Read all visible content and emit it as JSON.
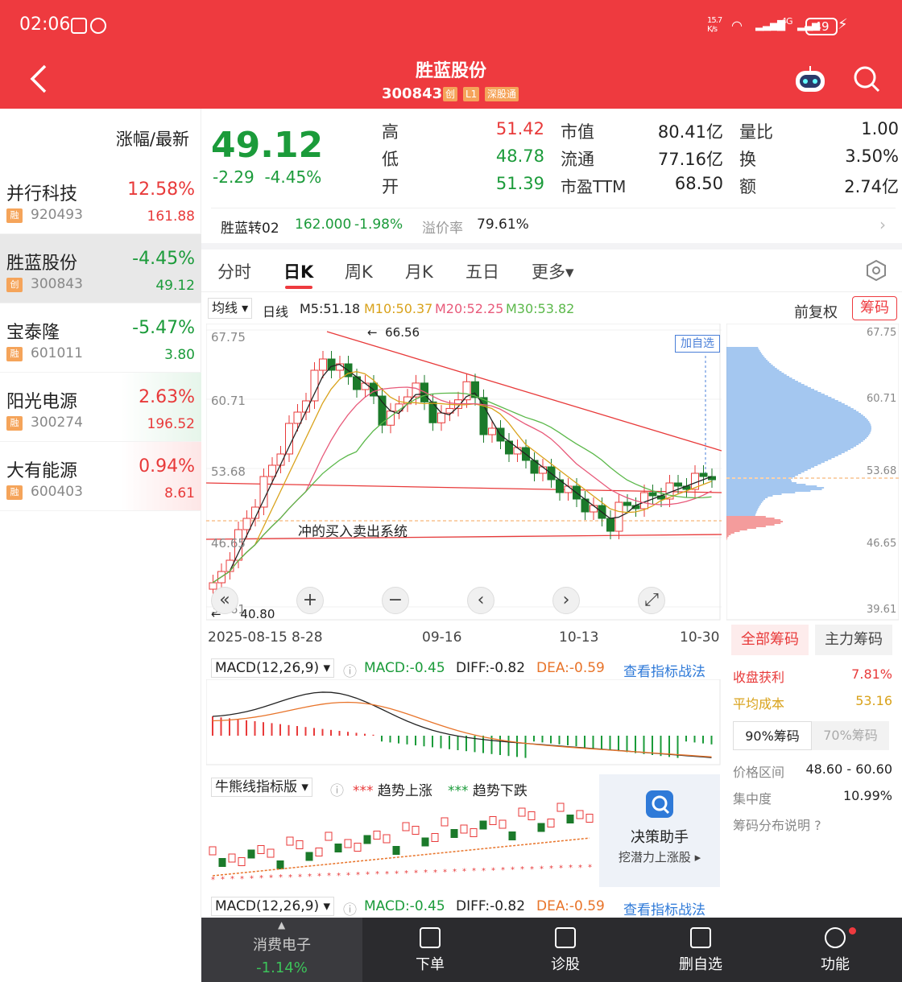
{
  "status": {
    "time": "02:06",
    "speed": "15.7\nK/s",
    "network": "4G",
    "battery": "49"
  },
  "header": {
    "title": "胜蓝股份",
    "code": "300843",
    "tags": [
      "创",
      "L1",
      "深股通"
    ]
  },
  "sidebar": {
    "heading": "涨幅/最新",
    "items": [
      {
        "name": "并行科技",
        "tag": "融",
        "code": "920493",
        "pct": "12.58%",
        "price": "161.88",
        "dir": "up"
      },
      {
        "name": "胜蓝股份",
        "tag": "创",
        "code": "300843",
        "pct": "-4.45%",
        "price": "49.12",
        "dir": "down",
        "selected": true
      },
      {
        "name": "宝泰隆",
        "tag": "融",
        "code": "601011",
        "pct": "-5.47%",
        "price": "3.80",
        "dir": "down"
      },
      {
        "name": "阳光电源",
        "tag": "融",
        "code": "300274",
        "pct": "2.63%",
        "price": "196.52",
        "dir": "up"
      },
      {
        "name": "大有能源",
        "tag": "融",
        "code": "600403",
        "pct": "0.94%",
        "price": "8.61",
        "dir": "up"
      }
    ]
  },
  "quote": {
    "price": "49.12",
    "change": "-2.29",
    "change_pct": "-4.45%",
    "high_label": "高",
    "high": "51.42",
    "low_label": "低",
    "low": "48.78",
    "open_label": "开",
    "open": "51.39",
    "mcap_label": "市值",
    "mcap": "80.41亿",
    "float_label": "流通",
    "float": "77.16亿",
    "pe_label": "市盈TTM",
    "pe": "68.50",
    "vr_label": "量比",
    "vr": "1.00",
    "turn_label": "换",
    "turn": "3.50%",
    "amt_label": "额",
    "amt": "2.74亿"
  },
  "bond": {
    "name": "胜蓝转02",
    "price": "162.000",
    "change": "-1.98%",
    "premium_label": "溢价率",
    "premium": "79.61%"
  },
  "tabs": [
    "分时",
    "日K",
    "周K",
    "月K",
    "五日",
    "更多▾"
  ],
  "indicators": {
    "ma_selector": "均线 ▾",
    "period": "日线",
    "m5": "M5:51.18",
    "m10": "M10:50.37",
    "m20": "M20:52.25",
    "m30": "M30:53.82",
    "adjust": "前复权",
    "chip_btn": "筹码"
  },
  "chart": {
    "y_labels": [
      "67.75",
      "60.71",
      "53.68",
      "46.65",
      "39.61"
    ],
    "chip_y_labels": [
      "67.75",
      "60.71",
      "53.68",
      "46.65",
      "39.61"
    ],
    "dates": [
      "2025-08-15",
      "8-28",
      "09-16",
      "10-13",
      "10-30"
    ],
    "hi_mark": "66.56",
    "lo_mark": "40.80",
    "add_watch": "加自选",
    "annotation": "冲的买入卖出系统",
    "zoom": [
      "«",
      "+",
      "−",
      "‹",
      "›",
      "⤢"
    ]
  },
  "chip_panel": {
    "tab_all": "全部筹码",
    "tab_main": "主力筹码",
    "profit_label": "收盘获利",
    "profit": "7.81%",
    "cost_label": "平均成本",
    "cost": "53.16",
    "seg_90": "90%筹码",
    "seg_70": "70%筹码",
    "range_label": "价格区间",
    "range": "48.60 - 60.60",
    "conc_label": "集中度",
    "conc": "10.99%",
    "help": "筹码分布说明 ?"
  },
  "macd": {
    "name": "MACD(12,26,9) ▾",
    "macd": "MACD:-0.45",
    "diff": "DIFF:-0.82",
    "dea": "DEA:-0.59",
    "link": "查看指标战法"
  },
  "bull": {
    "name": "牛熊线指标版 ▾",
    "up": "*** 趋势上涨",
    "down": "*** 趋势下跌",
    "assist_title": "决策助手",
    "assist_sub": "挖潜力上涨股 ▸"
  },
  "bottom": {
    "sector": "消费电子",
    "sector_pct": "-1.14%",
    "items": [
      "下单",
      "诊股",
      "删自选",
      "功能"
    ]
  },
  "colors": {
    "up": "#e83a3a",
    "down": "#1b9b3a",
    "header": "#ee3a3f",
    "m5": "#222222",
    "m10": "#d9a21b",
    "m20": "#e85a7a",
    "m30": "#5bb84a"
  }
}
